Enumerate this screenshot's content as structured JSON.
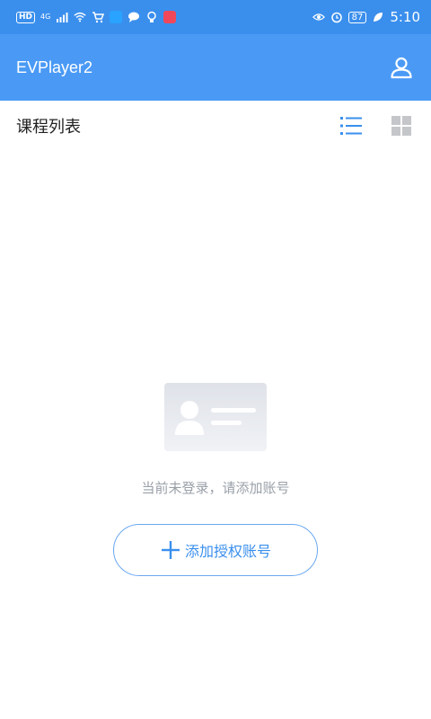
{
  "status_bar": {
    "hd_label": "HD",
    "network_label": "4G",
    "battery": "87",
    "time": "5:10"
  },
  "app_bar": {
    "title": "EVPlayer2",
    "user_icon": "user-icon"
  },
  "course_list": {
    "title": "课程列表",
    "list_view_icon": "list-view-icon",
    "grid_view_icon": "grid-view-icon"
  },
  "empty_state": {
    "message": "当前未登录，请添加账号",
    "add_button_label": "添加授权账号"
  },
  "colors": {
    "primary": "#4a9af5",
    "statusbar": "#3a8fed",
    "accent": "#3a8fed",
    "muted_text": "#9aa0a8"
  }
}
